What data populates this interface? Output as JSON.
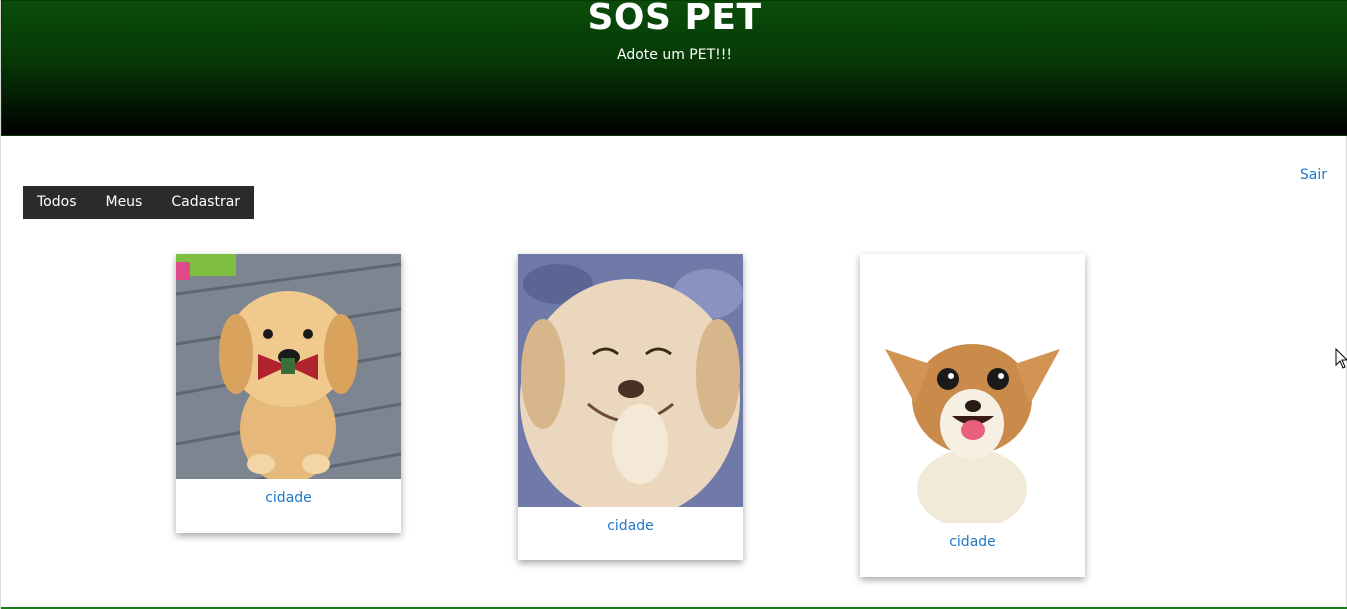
{
  "header": {
    "title": "SOS PET",
    "subtitle": "Adote um PET!!!"
  },
  "nav": {
    "logout_label": "Sair",
    "items": [
      {
        "label": "Todos"
      },
      {
        "label": "Meus"
      },
      {
        "label": "Cadastrar"
      }
    ]
  },
  "pets": [
    {
      "caption": "cidade",
      "image": "golden-puppy-with-bow-tie"
    },
    {
      "caption": "cidade",
      "image": "laughing-fluffy-puppy"
    },
    {
      "caption": "cidade",
      "image": "smiling-chihuahua"
    }
  ],
  "colors": {
    "header_top": "#0a4d0a",
    "header_bottom": "#000000",
    "link": "#1e78c8",
    "nav_bg": "#2b2b2b"
  }
}
